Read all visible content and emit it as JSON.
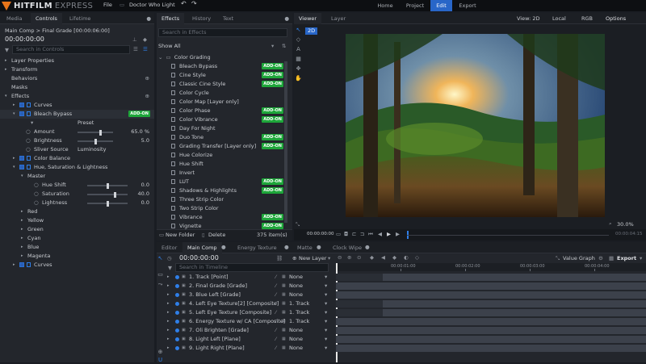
{
  "app": {
    "logo_primary": "HITFILM",
    "logo_secondary": "EXPRESS",
    "menu_file": "File",
    "project_name": "Doctor Who Light",
    "undo_icon": "undo-icon",
    "redo_icon": "redo-icon",
    "tabs": [
      "Home",
      "Project",
      "Edit",
      "Export"
    ],
    "active_tab": "Edit",
    "accent": "#2866c8"
  },
  "left_panel": {
    "tabs": [
      "Media",
      "Controls",
      "Lifetime"
    ],
    "active": "Controls",
    "comp_title": "Main Comp > Final Grade [00:00:06:00]",
    "timecode": "00:00:00:00",
    "search_placeholder": "Search in Controls",
    "tree": [
      {
        "label": "Layer Properties",
        "indent": 0
      },
      {
        "label": "Transform",
        "indent": 0
      },
      {
        "label": "Behaviors",
        "indent": 0
      },
      {
        "label": "Masks",
        "indent": 0
      },
      {
        "label": "Effects",
        "indent": 0
      },
      {
        "label": "Curves",
        "indent": 1
      },
      {
        "label": "Bleach Bypass",
        "indent": 1,
        "addon": "ADD-ON"
      },
      {
        "label": "Preset",
        "indent": 2
      },
      {
        "label": "Amount",
        "indent": 2,
        "value": "65.0 %"
      },
      {
        "label": "Brightness",
        "indent": 2,
        "value": "5.0"
      },
      {
        "label": "Sliver Source",
        "indent": 2,
        "value": "Luminosity"
      },
      {
        "label": "Color Balance",
        "indent": 1
      },
      {
        "label": "Hue, Saturation & Lightness",
        "indent": 1
      },
      {
        "label": "Master",
        "indent": 2
      },
      {
        "label": "Hue Shift",
        "indent": 3,
        "value": "0.0"
      },
      {
        "label": "Saturation",
        "indent": 3,
        "value": "40.0"
      },
      {
        "label": "Lightness",
        "indent": 3,
        "value": "0.0"
      },
      {
        "label": "Red",
        "indent": 2
      },
      {
        "label": "Yellow",
        "indent": 2
      },
      {
        "label": "Green",
        "indent": 2
      },
      {
        "label": "Cyan",
        "indent": 2
      },
      {
        "label": "Blue",
        "indent": 2
      },
      {
        "label": "Magenta",
        "indent": 2
      },
      {
        "label": "Curves",
        "indent": 1
      }
    ],
    "slider_levels": {
      "amount": 0.65,
      "brightness": 0.5,
      "hue_shift": 0.5,
      "saturation": 0.7,
      "lightness": 0.5
    }
  },
  "effects_panel": {
    "tabs": [
      "Effects",
      "History",
      "Text"
    ],
    "active": "Effects",
    "search_placeholder": "Search in Effects",
    "show_all": "Show All",
    "folder": "Color Grading",
    "items": [
      {
        "label": "Bleach Bypass",
        "addon": "ADD-ON"
      },
      {
        "label": "Cine Style",
        "addon": "ADD-ON"
      },
      {
        "label": "Classic Cine Style",
        "addon": "ADD-ON"
      },
      {
        "label": "Color Cycle",
        "addon": ""
      },
      {
        "label": "Color Map [Layer only]",
        "addon": ""
      },
      {
        "label": "Color Phase",
        "addon": "ADD-ON"
      },
      {
        "label": "Color Vibrance",
        "addon": "ADD-ON"
      },
      {
        "label": "Day For Night",
        "addon": ""
      },
      {
        "label": "Duo Tone",
        "addon": "ADD-ON"
      },
      {
        "label": "Grading Transfer [Layer only]",
        "addon": "ADD-ON"
      },
      {
        "label": "Hue Colorize",
        "addon": ""
      },
      {
        "label": "Hue Shift",
        "addon": ""
      },
      {
        "label": "Invert",
        "addon": ""
      },
      {
        "label": "LUT",
        "addon": "ADD-ON"
      },
      {
        "label": "Shadows & Highlights",
        "addon": "ADD-ON"
      },
      {
        "label": "Three Strip Color",
        "addon": ""
      },
      {
        "label": "Two Strip Color",
        "addon": ""
      },
      {
        "label": "Vibrance",
        "addon": "ADD-ON"
      },
      {
        "label": "Vignette",
        "addon": "ADD-ON"
      }
    ],
    "new_folder": "New Folder",
    "delete": "Delete",
    "count": "375 item(s)"
  },
  "viewer": {
    "tabs": [
      "Viewer",
      "Layer"
    ],
    "active": "Viewer",
    "view_mode": "View: 2D",
    "space": "Local",
    "channel": "RGB",
    "options": "Options",
    "badge": "2D",
    "timecode_left": "00:00:00:00",
    "timecode_right": "00:00:04:15",
    "zoom": "30.0%"
  },
  "timeline": {
    "tabs": [
      "Editor",
      "Main Comp",
      "Energy Texture",
      "Matte",
      "Clock Wipe"
    ],
    "active": "Main Comp",
    "timecode": "00:00:00:00",
    "new_layer": "New Layer",
    "search_placeholder": "Search in Timeline",
    "value_graph": "Value Graph",
    "export": "Export",
    "ruler": [
      "00:00:01:00",
      "00:00:02:00",
      "00:00:03:00",
      "00:00:04:00"
    ],
    "layers": [
      {
        "name": "1. Track [Point]",
        "parent": "None"
      },
      {
        "name": "2. Final Grade [Grade]",
        "parent": "None"
      },
      {
        "name": "3. Blue Left [Grade]",
        "parent": "None"
      },
      {
        "name": "4. Left Eye Texture[2] [Composite]",
        "parent": "1. Track"
      },
      {
        "name": "5. Left Eye Texture [Composite]",
        "parent": "1. Track"
      },
      {
        "name": "6. Energy Texture w/ CA [Composite]",
        "parent": "1. Track"
      },
      {
        "name": "7. Oli Brighten [Grade]",
        "parent": "None"
      },
      {
        "name": "8. Light Left [Plane]",
        "parent": "None"
      },
      {
        "name": "9. Light Right [Plane]",
        "parent": "None"
      }
    ],
    "clip_starts": [
      0.12,
      0.0,
      0.0,
      0.12,
      0.12,
      0.0,
      0.0,
      0.0,
      0.0
    ]
  }
}
